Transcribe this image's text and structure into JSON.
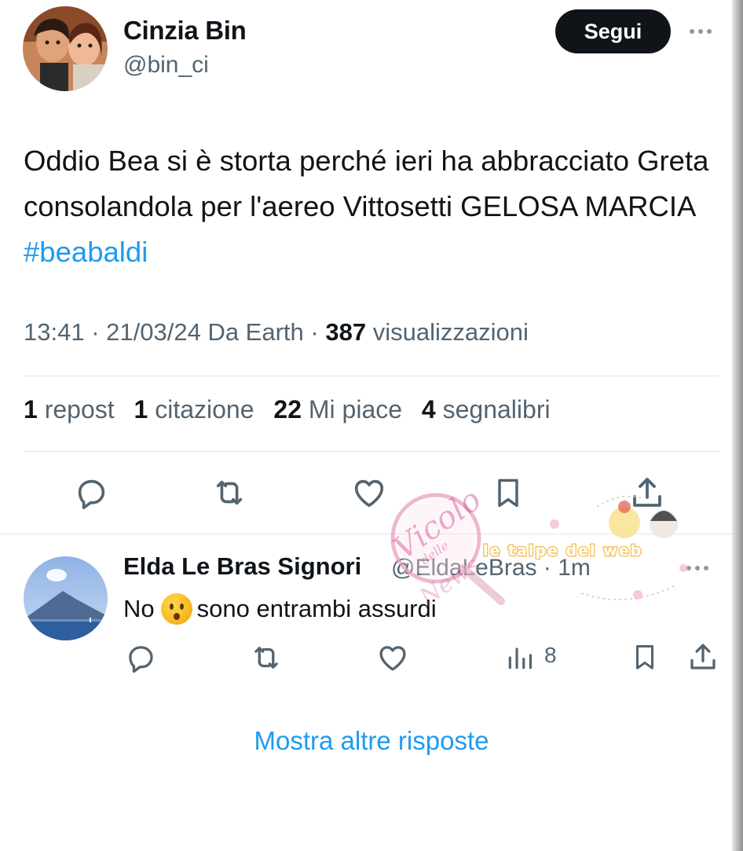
{
  "tweet": {
    "author_name": "Cinzia Bin",
    "author_handle": "@bin_ci",
    "follow_label": "Segui",
    "text": "Oddio Bea si è storta perché ieri ha abbracciato Greta consolandola per l'aereo Vittosetti GELOSA MARCIA ",
    "hashtag": "#beabaldi",
    "time": "13:41",
    "date": "21/03/24",
    "source": "Da Earth",
    "views_count": "387",
    "views_label": "visualizzazioni",
    "stats": {
      "reposts_count": "1",
      "reposts_label": "repost",
      "quotes_count": "1",
      "quotes_label": "citazione",
      "likes_count": "22",
      "likes_label": "Mi piace",
      "bookmarks_count": "4",
      "bookmarks_label": "segnalibri"
    },
    "actions": [
      "reply-icon",
      "repost-icon",
      "like-icon",
      "bookmark-icon",
      "share-icon"
    ]
  },
  "reply": {
    "author_name": "Elda Le Bras Signori",
    "author_handle": "@EldaLeBras",
    "time": "1m",
    "text_before": "No",
    "emoji": "hushed-face-emoji",
    "text_after": "sono entrambi assurdi",
    "views_count": "8",
    "actions": [
      "reply-icon",
      "repost-icon",
      "like-icon",
      "views-icon",
      "bookmark-icon",
      "share-icon"
    ]
  },
  "show_more_label": "Mostra altre risposte",
  "watermark": {
    "logo_text": "Vicolo delle News",
    "banner_text": "le talpe del web"
  },
  "colors": {
    "text": "#0f1419",
    "secondary": "#536471",
    "link": "#1d9bf0",
    "button_bg": "#0f1419",
    "divider": "#e3e7ea"
  }
}
